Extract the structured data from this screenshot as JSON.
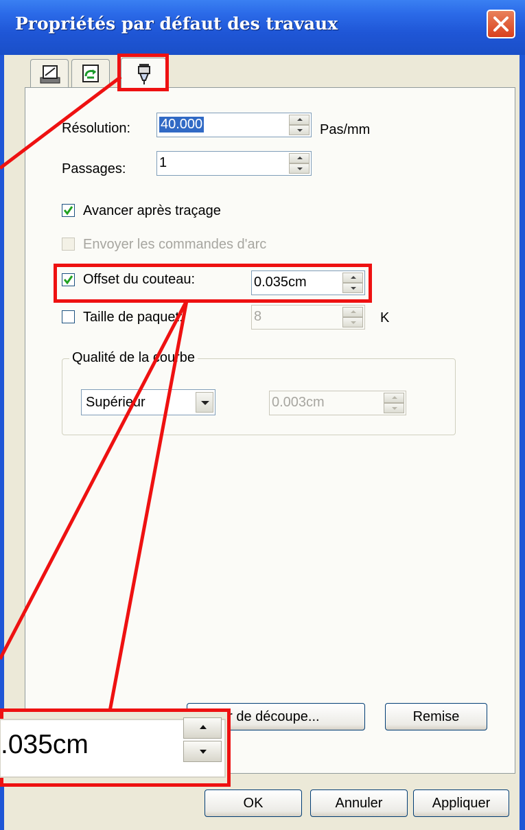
{
  "window": {
    "title": "Propriétés par défaut des travaux"
  },
  "tabs": [
    {
      "icon": "plotter-icon"
    },
    {
      "icon": "arrow-refresh-icon"
    },
    {
      "icon": "knife-tool-icon",
      "active": true
    }
  ],
  "fields": {
    "resolution": {
      "label": "Résolution:",
      "value": "40.000",
      "unit": "Pas/mm"
    },
    "passes": {
      "label": "Passages:",
      "value": "1"
    },
    "advance_after_plot": {
      "label": "Avancer après traçage",
      "checked": true
    },
    "send_arc_commands": {
      "label": "Envoyer les commandes d'arc",
      "checked": false,
      "disabled": true
    },
    "knife_offset": {
      "label": "Offset du couteau:",
      "value": "0.035cm",
      "checked": true
    },
    "packet_size": {
      "label": "Taille de paquet:",
      "value": "8",
      "unit": "K",
      "checked": false
    }
  },
  "curve_quality": {
    "title": "Qualité de la courbe",
    "selected": "Supérieur",
    "value": "0.003cm"
  },
  "buttons": {
    "cutter": "ur de découpe...",
    "reset": "Remise",
    "ok": "OK",
    "cancel": "Annuler",
    "apply": "Appliquer"
  },
  "zoom": {
    "value": ".035cm"
  },
  "colors": {
    "highlight": "#ee1111",
    "titlebar": "#1f56d6"
  }
}
